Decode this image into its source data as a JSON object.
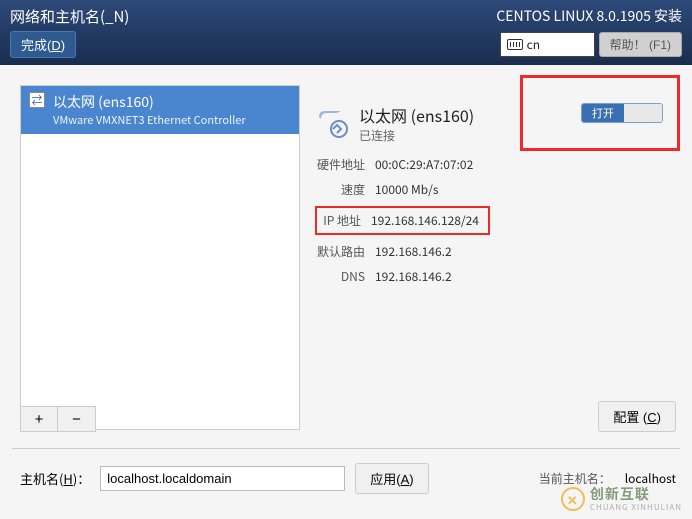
{
  "header": {
    "title": "网络和主机名(_N)",
    "done_btn": "完成(D)",
    "product": "CENTOS LINUX 8.0.1905 安装",
    "lang": "cn",
    "help_btn": "帮助！ (F1)"
  },
  "nic_list": {
    "item": {
      "title": "以太网 (ens160)",
      "subtitle": "VMware VMXNET3 Ethernet Controller"
    }
  },
  "detail": {
    "title": "以太网 (ens160)",
    "status": "已连接",
    "hw_label": "硬件地址",
    "hw_value": "00:0C:29:A7:07:02",
    "speed_label": "速度",
    "speed_value": "10000 Mb/s",
    "ip_label": "IP 地址",
    "ip_value": "192.168.146.128/24",
    "route_label": "默认路由",
    "route_value": "192.168.146.2",
    "dns_label": "DNS",
    "dns_value": "192.168.146.2",
    "toggle_on": "打开"
  },
  "buttons": {
    "add": "+",
    "remove": "−",
    "configure": "配置 (C)",
    "apply": "应用(A)"
  },
  "hostname": {
    "label": "主机名(H)：",
    "value": "localhost.localdomain",
    "current_label": "当前主机名：",
    "current_value": "localhost"
  },
  "watermark": {
    "brand": "创新互联",
    "sub": "CHUANG XINHULIAN"
  }
}
